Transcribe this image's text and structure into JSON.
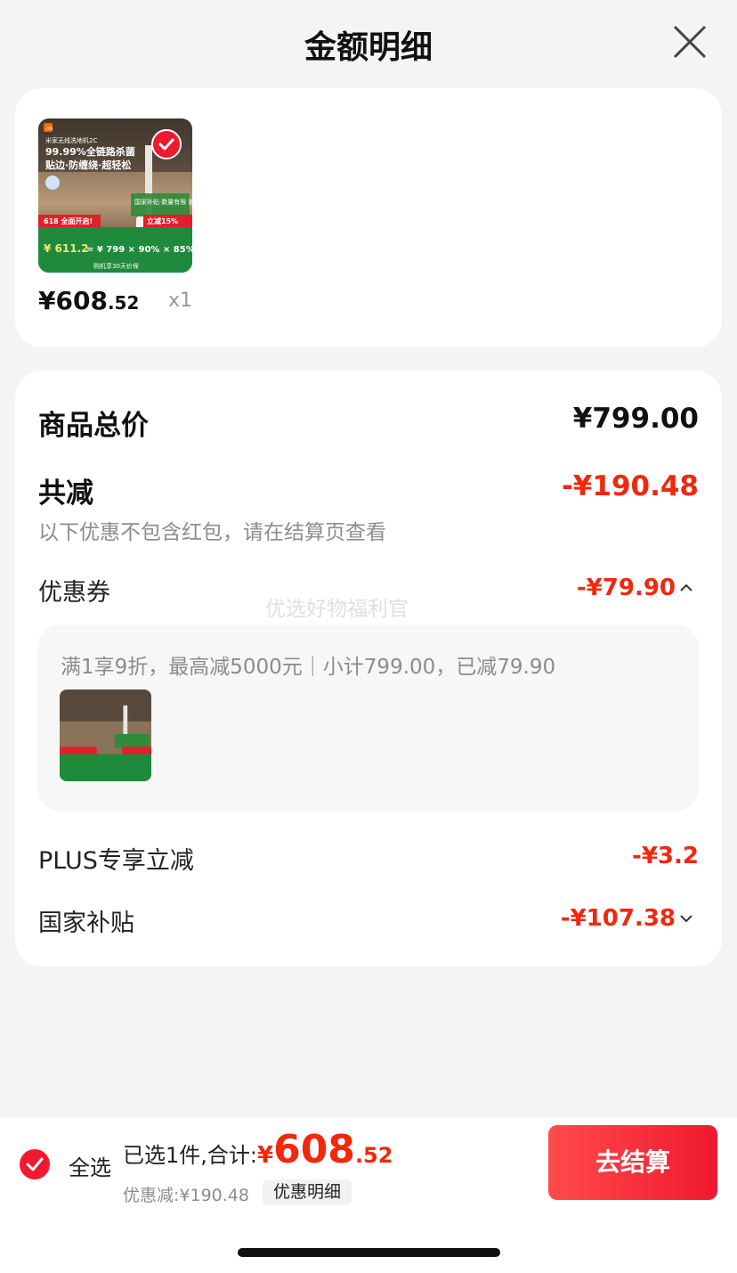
{
  "header": {
    "title": "金额明细"
  },
  "product": {
    "price_int": "¥608",
    "price_dec": ".52",
    "qty": "x1",
    "image": {
      "brand": "mi",
      "line1": "米家无线洗地机2C",
      "line2": "99.99%全链路杀菌",
      "line3": "贴边·防缠绕·超轻松",
      "campaign": "618 全面开启!",
      "promo": "国家补贴·数量有限 随时结束!",
      "extra_discount": "立减15%",
      "formula_result": "¥ 611.2",
      "formula_terms": "= ¥ 799 × 90% × 85%",
      "footer": "购机享30天价保"
    }
  },
  "summary": {
    "total_label": "商品总价",
    "total_value": "¥799.00",
    "reduce_label": "共减",
    "reduce_value": "-¥190.48",
    "reduce_note": "以下优惠不包含红包，请在结算页查看"
  },
  "coupon": {
    "label": "优惠券",
    "value": "-¥79.90",
    "expanded_icon": "chevron-up-icon",
    "detail_text": "满1享9折，最高减5000元｜小计799.00，已减79.90"
  },
  "watermark": "优选好物福利官",
  "plus": {
    "label": "PLUS专享立减",
    "value": "-¥3.2"
  },
  "subsidy": {
    "label": "国家补贴",
    "value": "-¥107.38",
    "collapsed_icon": "chevron-down-icon"
  },
  "bottom": {
    "select_all": "全选",
    "selected_label": "已选1件,合计:",
    "total_yen": "¥",
    "total_int": "608",
    "total_dec": ".52",
    "discount_text": "优惠减:¥190.48",
    "detail_chip": "优惠明细",
    "checkout": "去结算"
  },
  "colors": {
    "accent_red": "#f2270c",
    "check_red": "#f0192f"
  }
}
